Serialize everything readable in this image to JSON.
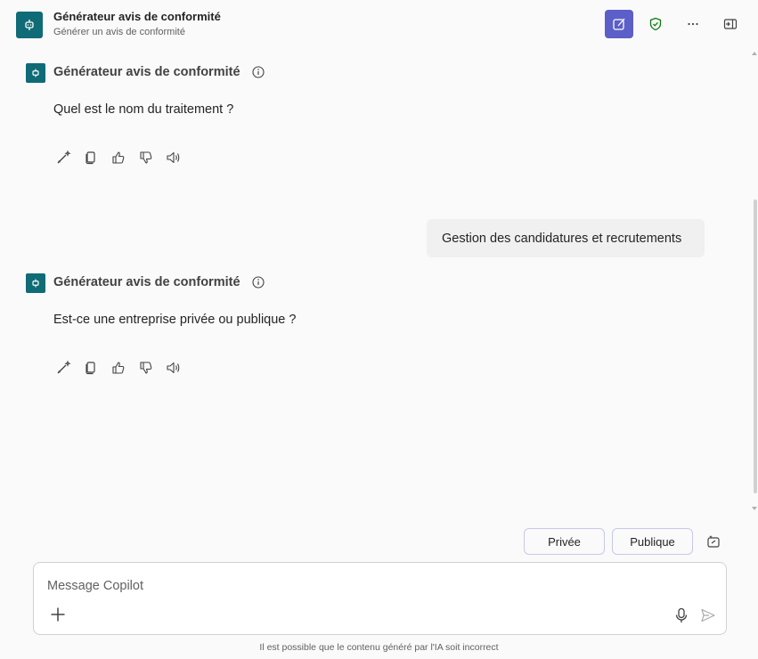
{
  "header": {
    "title": "Générateur avis de conformité",
    "subtitle": "Générer un avis de conformité",
    "icons": [
      "new-chat-icon",
      "shield-check-icon",
      "more-icon",
      "side-panel-icon"
    ],
    "accent": "#5b5fc7",
    "brand": "#0f6b75"
  },
  "messages": [
    {
      "role": "bot",
      "sender": "Générateur avis de conformité",
      "text": "Quel est le nom du traitement ?"
    },
    {
      "role": "user",
      "text": "Gestion des candidatures et recrutements"
    },
    {
      "role": "bot",
      "sender": "Générateur avis de conformité",
      "text": "Est-ce une entreprise privée ou publique ?"
    }
  ],
  "message_actions": [
    "edit-sparkle-icon",
    "copy-icon",
    "thumbs-up-icon",
    "thumbs-down-icon",
    "speaker-icon"
  ],
  "suggestions": [
    "Privée",
    "Publique"
  ],
  "composer": {
    "placeholder": "Message Copilot",
    "value": ""
  },
  "disclaimer": "Il est possible que le contenu généré par l'IA soit incorrect"
}
